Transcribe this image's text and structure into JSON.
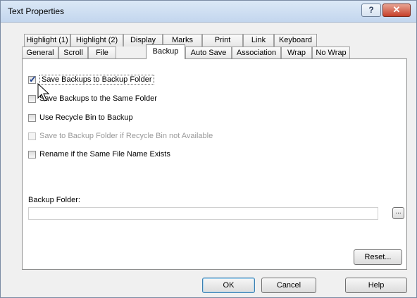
{
  "window": {
    "title": "Text Properties",
    "help_glyph": "?",
    "close_glyph": "✕"
  },
  "tabs_row1": [
    "Highlight (1)",
    "Highlight (2)",
    "Display",
    "Marks",
    "Print",
    "Link",
    "Keyboard"
  ],
  "tabs_row2": [
    "General",
    "Scroll",
    "File",
    "Backup",
    "Auto Save",
    "Association",
    "Wrap",
    "No Wrap"
  ],
  "active_tab": "Backup",
  "options": [
    {
      "label": "Save Backups to Backup Folder",
      "checked": true,
      "enabled": true
    },
    {
      "label": "Save Backups to the Same Folder",
      "checked": false,
      "enabled": true
    },
    {
      "label": "Use Recycle Bin to Backup",
      "checked": false,
      "enabled": true
    },
    {
      "label": "Save to Backup Folder if Recycle Bin not Available",
      "checked": false,
      "enabled": false
    },
    {
      "label": "Rename if the Same File Name Exists",
      "checked": false,
      "enabled": true
    }
  ],
  "backup_folder": {
    "label": "Backup Folder:",
    "value": "",
    "browse_label": "..."
  },
  "buttons": {
    "reset": "Reset...",
    "ok": "OK",
    "cancel": "Cancel",
    "help": "Help"
  }
}
